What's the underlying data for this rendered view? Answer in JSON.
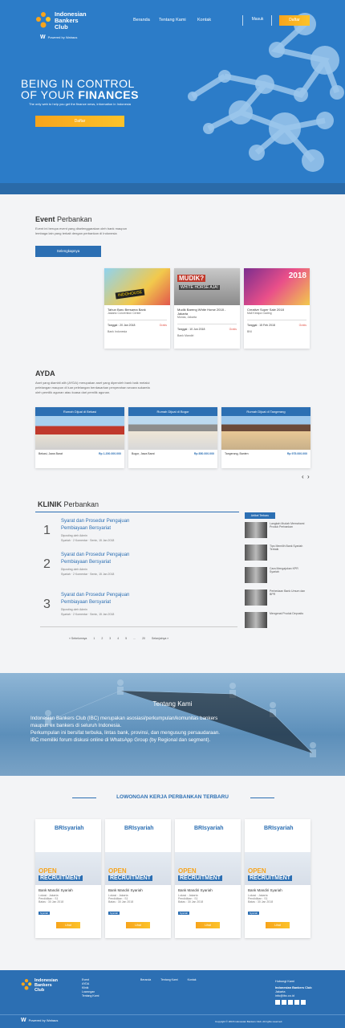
{
  "brand": {
    "name_line1": "Indonesian",
    "name_line2": "Bankers",
    "name_line3": "Club",
    "powered": "Powered by Wahaus"
  },
  "nav": {
    "items": [
      "Beranda",
      "Tentang Kami",
      "Kontak"
    ],
    "login": "Masuk",
    "register": "Daftar"
  },
  "hero": {
    "line1": "BEING IN CONTROL",
    "line2a": "OF YOUR ",
    "line2b": "FINANCES",
    "subtitle": "The only web to help you get the finance news, information in Indonesia",
    "cta": "Daftar"
  },
  "events": {
    "title_bold": "Event",
    "title_rest": " Perbankan",
    "desc1": "Event ini berupa event yang diselenggarakan oleh bank maupun",
    "desc2": "lembaga lain yang terkait dengan perbankan di Indonesia",
    "button": "Selengkapnya",
    "cards": [
      {
        "title": "Tahun Baru Bersama Bank",
        "meta": "Jakarta Convention Center",
        "date": "Tanggal : 20 Jan 2018",
        "status": "Gratis",
        "org": "Bank Indonesia"
      },
      {
        "title": "Mudik Bareng White Horse 2018 - Jakarta",
        "meta": "Monas, Jakarta",
        "date": "Tanggal : 10 Jun 2018",
        "status": "Gratis",
        "org": "Bank Mandiri"
      },
      {
        "title": "Creative Super Sale 2018",
        "meta": "Mall Kelapa Gading",
        "date": "Tanggal : 15 Feb 2018",
        "status": "Gratis",
        "org": "BNI"
      }
    ],
    "poster_labels": [
      "INDOHOUSE",
      "MUDIK?",
      "WHITE HORSE AJA!",
      "2018"
    ]
  },
  "ayda": {
    "title": "AYDA",
    "desc1": "Aset yang diambil alih (AYDA) merupakan aset yang diperoleh bank baik melalui",
    "desc2": "pelelangan maupun di luar pelelangan berdasarkan penyerahan secara sukarela",
    "desc3": "oleh pemilik agunan atau kuasa dari pemilik agunan.",
    "cards": [
      {
        "title": "Rumah Dijual di Bekasi",
        "price": "Rp 1.200.000.000",
        "loc": "Bekasi, Jawa Barat"
      },
      {
        "title": "Rumah Dijual di Bogor",
        "price": "Rp 850.000.000",
        "loc": "Bogor, Jawa Barat"
      },
      {
        "title": "Rumah Dijual di Tangerang",
        "price": "Rp 975.000.000",
        "loc": "Tangerang, Banten"
      }
    ],
    "prev": "‹",
    "next": "›"
  },
  "klinik": {
    "title_bold": "KLINIK",
    "title_rest": " Perbankan",
    "side_tab": "Artikel Terbaru",
    "items": [
      {
        "num": "1",
        "t1": "Syarat dan Prosedur Pengajuan",
        "t2": "Pembiayaan Bersyariat",
        "meta": "Diposting oleh Admin",
        "info": "Syariah · 2 Komentar · Senin, 15 Jan 2018"
      },
      {
        "num": "2",
        "t1": "Syarat dan Prosedur Pengajuan",
        "t2": "Pembiayaan Bersyariat",
        "meta": "Diposting oleh Admin",
        "info": "Syariah · 2 Komentar · Senin, 15 Jan 2018"
      },
      {
        "num": "3",
        "t1": "Syarat dan Prosedur Pengajuan",
        "t2": "Pembiayaan Bersyariat",
        "meta": "Diposting oleh Admin",
        "info": "Syariah · 2 Komentar · Senin, 15 Jan 2018"
      }
    ],
    "pagination": [
      "« Sebelumnya",
      "1",
      "2",
      "3",
      "4",
      "5",
      "...",
      "20",
      "Selanjutnya »"
    ],
    "side_items": [
      "Langkah Mudah Memahami Produk Perbankan",
      "Tips Memilih Bank Syariah Terbaik",
      "Cara Mengajukan KPR Syariah",
      "Perbedaan Bank Umum dan BPR",
      "Mengenal Produk Deposito"
    ]
  },
  "about": {
    "title": "Tentang Kami",
    "p1": "Indonesian Bankers Club (IBC) merupakan asosiasi/perkumpulan/komunitas bankers",
    "p2": "maupun ex bankers di seluruh Indonesia.",
    "p3": "Perkumpulan ini bersifat terbuka, lintas bank, provinsi, dan mengusung persaudaraan.",
    "p4": "IBC memiliki forum diskusi online di WhatsApp Group (by Regional dan segment)."
  },
  "jobs": {
    "title": "LOWONGAN KERJA PERBANKAN TERBARU",
    "cards": [
      {
        "logo": "BRIsyariah",
        "open": "OPEN",
        "recruit": "RECRUITMENT",
        "bank": "Bank Mandiri Syariah",
        "l1": "Lokasi : Jakarta",
        "l2": "Pendidikan : S1",
        "l3": "Batas : 30 Jan 2018",
        "tag": "Syariah",
        "btn": "Lihat"
      },
      {
        "logo": "BRIsyariah",
        "open": "OPEN",
        "recruit": "RECRUITMENT",
        "bank": "Bank Mandiri Syariah",
        "l1": "Lokasi : Jakarta",
        "l2": "Pendidikan : S1",
        "l3": "Batas : 30 Jan 2018",
        "tag": "Syariah",
        "btn": "Lihat"
      },
      {
        "logo": "BRIsyariah",
        "open": "OPEN",
        "recruit": "RECRUITMENT",
        "bank": "Bank Mandiri Syariah",
        "l1": "Lokasi : Jakarta",
        "l2": "Pendidikan : S1",
        "l3": "Batas : 30 Jan 2018",
        "tag": "Syariah",
        "btn": "Lihat"
      },
      {
        "logo": "BRIsyariah",
        "open": "OPEN",
        "recruit": "RECRUITMENT",
        "bank": "Bank Mandiri Syariah",
        "l1": "Lokasi : Jakarta",
        "l2": "Pendidikan : S1",
        "l3": "Batas : 30 Jan 2018",
        "tag": "Syariah",
        "btn": "Lihat"
      }
    ]
  },
  "footer": {
    "col1": [
      "Event",
      "AYDA",
      "Klinik",
      "Lowongan",
      "Tentang Kami"
    ],
    "col2": [
      "Beranda",
      "Tentang Kami",
      "Kontak"
    ],
    "contact_title": "Hubungi Kami",
    "contact_name": "Indonesian Bankers Club",
    "contact_l1": "Jakarta",
    "contact_l2": "info@ibc.co.id",
    "powered": "Powered by Wahaus",
    "copyright": "Copyright © 2018 Indonesian Bankers Club. All rights reserved."
  },
  "colors": {
    "primary": "#2c7cc8",
    "orange": "#f7a41c",
    "dark_blue": "#2c6fb3"
  }
}
